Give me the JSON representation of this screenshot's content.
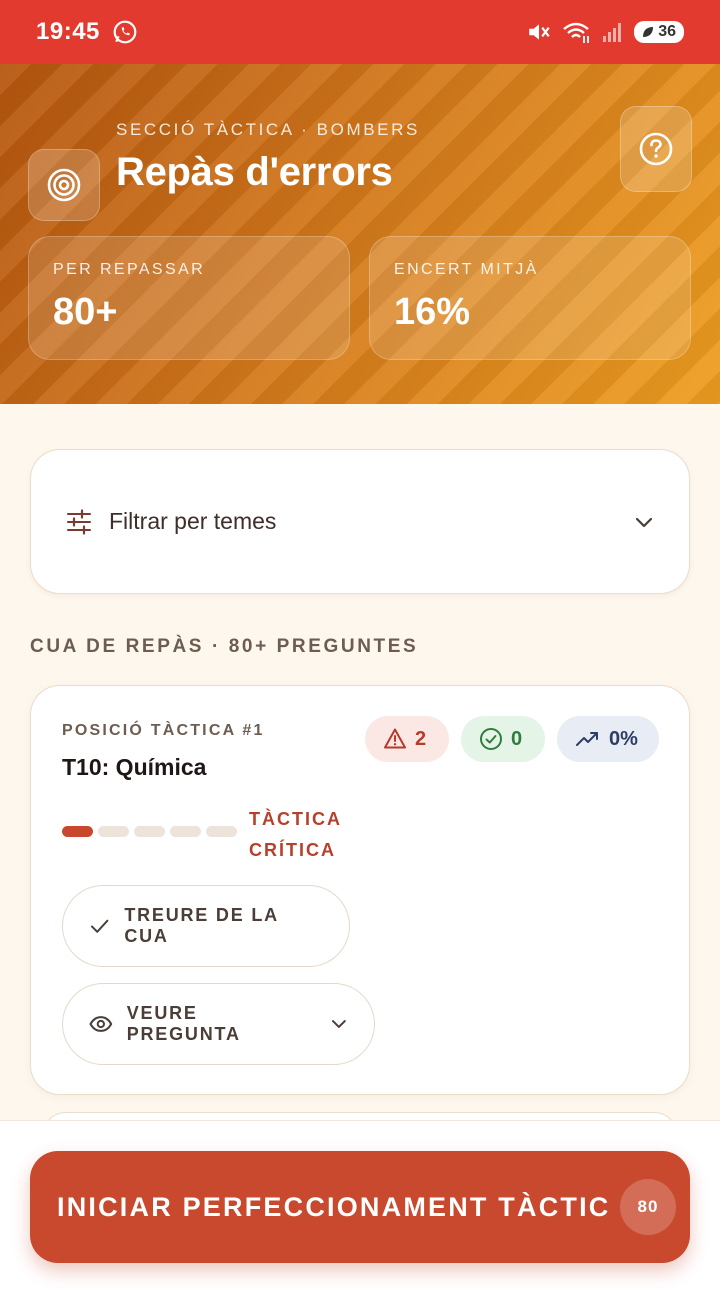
{
  "status_bar": {
    "time": "19:45",
    "battery": "36"
  },
  "header": {
    "kicker": "SECCIÓ TÀCTICA · BOMBERS",
    "title": "Repàs d'errors",
    "stats": [
      {
        "label": "PER REPASSAR",
        "value": "80+"
      },
      {
        "label": "ENCERT MITJÀ",
        "value": "16%"
      }
    ]
  },
  "filter": {
    "label": "Filtrar per temes"
  },
  "queue": {
    "title": "CUA DE REPÀS · 80+ PREGUNTES",
    "items": [
      {
        "position": "POSICIÓ TÀCTICA #1",
        "topic": "T10: Química",
        "badges": {
          "errors": "2",
          "correct": "0",
          "trend": "0%"
        },
        "severity_level": 1,
        "severity_max": 5,
        "severity_label": "TÀCTICA CRÍTICA",
        "remove_label": "TREURE DE LA CUA",
        "view_label": "VEURE PREGUNTA"
      }
    ]
  },
  "cta": {
    "label": "INICIAR PERFECCIONAMENT TÀCTIC",
    "count": "80"
  },
  "colors": {
    "status_bar": "#e23a2e",
    "accent": "#c8492d",
    "header_start": "#b5560f",
    "header_end": "#ef9e20"
  }
}
